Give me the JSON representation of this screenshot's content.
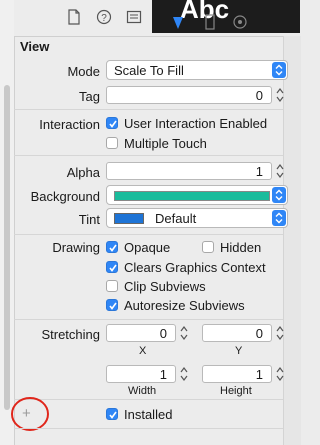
{
  "overlay": {
    "text": "Abc"
  },
  "section": {
    "title": "View"
  },
  "mode": {
    "label": "Mode",
    "value": "Scale To Fill"
  },
  "tag": {
    "label": "Tag",
    "value": "0"
  },
  "interaction": {
    "label": "Interaction",
    "user_interaction": "User Interaction Enabled",
    "multiple_touch": "Multiple Touch"
  },
  "alpha": {
    "label": "Alpha",
    "value": "1"
  },
  "background": {
    "label": "Background",
    "color": "#1abc9c"
  },
  "tint": {
    "label": "Tint",
    "value": "Default",
    "color": "#1e74d6"
  },
  "drawing": {
    "label": "Drawing",
    "opaque": "Opaque",
    "hidden": "Hidden",
    "clears": "Clears Graphics Context",
    "clip": "Clip Subviews",
    "autoresize": "Autoresize Subviews"
  },
  "stretching": {
    "label": "Stretching",
    "x": "0",
    "y": "0",
    "x_label": "X",
    "y_label": "Y",
    "width": "1",
    "height": "1",
    "width_label": "Width",
    "height_label": "Height"
  },
  "installed": {
    "label": "Installed",
    "add": "+"
  },
  "colors": {
    "accent": "#2f86f6",
    "annotation": "#e0261b"
  }
}
